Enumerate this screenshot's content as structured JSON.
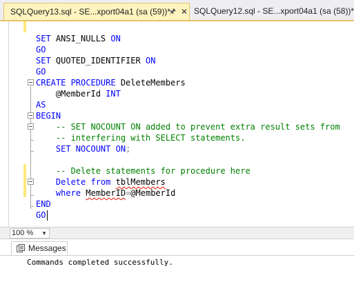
{
  "tabs": [
    {
      "title": "SQLQuery13.sql - SE...xport04a1 (sa (59))*",
      "active": true
    },
    {
      "title": "SQLQuery12.sql - SE...xport04a1 (sa (58))*",
      "active": false
    }
  ],
  "tab_icons": {
    "pin": "pin-icon",
    "close": "close-icon"
  },
  "editor": {
    "lines": [
      {
        "k1": "SET",
        "t1": " ANSI_NULLS ",
        "k2": "ON"
      },
      {
        "k1": "GO"
      },
      {
        "k1": "SET",
        "t1": " QUOTED_IDENTIFIER ",
        "k2": "ON"
      },
      {
        "k1": "GO"
      },
      {
        "k1": "CREATE PROCEDURE",
        "t1": " DeleteMembers"
      },
      {
        "indent": "    ",
        "t1": "@MemberId ",
        "k2": "INT"
      },
      {
        "k1": "AS"
      },
      {
        "k1": "BEGIN"
      },
      {
        "indent": "    ",
        "c": "-- SET NOCOUNT ON added to prevent extra result sets from"
      },
      {
        "indent": "    ",
        "c": "-- interfering with SELECT statements."
      },
      {
        "indent": "    ",
        "k1": "SET NOCOUNT ON",
        "o": ";"
      },
      {
        "indent": "    ",
        "c": "-- Delete statements for procedure here"
      },
      {
        "indent": "    ",
        "k1": "Delete from",
        "sp": " ",
        "u": "tblMembers"
      },
      {
        "indent": "    ",
        "k1": "where",
        "sp": " ",
        "u": "MemberID",
        "o": "=",
        "t1": "@MemberId"
      },
      {
        "k1": "END"
      },
      {
        "k1": "GO"
      }
    ]
  },
  "zoom": {
    "value": "100 %",
    "arrow_icon": "chevron-down-icon"
  },
  "results": {
    "tab_label": "Messages",
    "tab_icon": "messages-icon",
    "message": "Commands completed successfully."
  }
}
